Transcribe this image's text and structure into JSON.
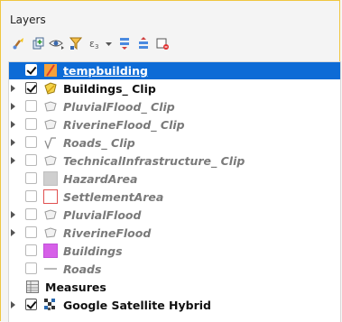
{
  "panel": {
    "title": "Layers"
  },
  "toolbar": {
    "buttons": [
      {
        "name": "style-manager-icon"
      },
      {
        "name": "add-group-icon"
      },
      {
        "name": "manage-visibility-icon"
      },
      {
        "name": "filter-legend-icon"
      },
      {
        "name": "filter-expression-icon"
      },
      {
        "name": "expand-all-icon"
      },
      {
        "name": "collapse-all-icon"
      },
      {
        "name": "remove-layer-icon"
      }
    ]
  },
  "layers": [
    {
      "label": "tempbuilding",
      "checked": true,
      "expander": false,
      "icon": "line-icon",
      "style": "selected"
    },
    {
      "label": "Buildings_ Clip",
      "checked": true,
      "expander": true,
      "icon": "polygon-icon",
      "style": "bold"
    },
    {
      "label": "PluvialFlood_ Clip",
      "checked": false,
      "expander": true,
      "icon": "polygon-icon",
      "style": "ghost"
    },
    {
      "label": "RiverineFlood_ Clip",
      "checked": false,
      "expander": true,
      "icon": "polygon-icon",
      "style": "ghost"
    },
    {
      "label": "Roads_ Clip",
      "checked": false,
      "expander": true,
      "icon": "linestring-icon",
      "style": "ghost"
    },
    {
      "label": "TechnicalInfrastructure_ Clip",
      "checked": false,
      "expander": true,
      "icon": "polygon-icon",
      "style": "ghost"
    },
    {
      "label": "HazardArea",
      "checked": false,
      "expander": false,
      "icon": "gray-fill-icon",
      "style": "ghost"
    },
    {
      "label": "SettlementArea",
      "checked": false,
      "expander": false,
      "icon": "red-outline-icon",
      "style": "ghost"
    },
    {
      "label": "PluvialFlood",
      "checked": false,
      "expander": true,
      "icon": "polygon-icon",
      "style": "ghost"
    },
    {
      "label": "RiverineFlood",
      "checked": false,
      "expander": true,
      "icon": "polygon-icon",
      "style": "ghost"
    },
    {
      "label": "Buildings",
      "checked": false,
      "expander": false,
      "icon": "magenta-fill-icon",
      "style": "ghost"
    },
    {
      "label": "Roads",
      "checked": false,
      "expander": false,
      "icon": "dash-line-icon",
      "style": "ghost"
    },
    {
      "label": "Measures",
      "checked": null,
      "expander": false,
      "icon": "table-icon",
      "style": "bold"
    },
    {
      "label": "Google Satellite Hybrid",
      "checked": true,
      "expander": true,
      "icon": "raster-icon",
      "style": "bold"
    }
  ],
  "colors": {
    "selection": "#0d6bd6",
    "panel_border": "#f0c640",
    "magenta_fill": "#d660e8",
    "red_outline": "#e05050"
  }
}
